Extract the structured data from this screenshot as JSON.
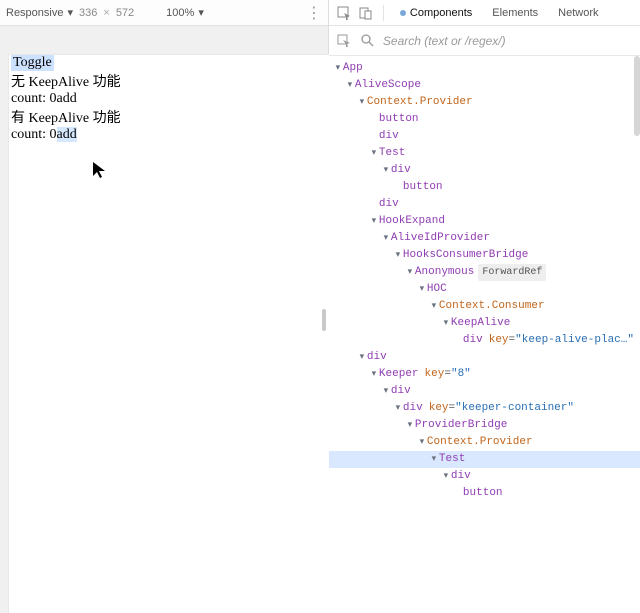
{
  "toolbar": {
    "device": "Responsive",
    "width": "336",
    "x": "×",
    "height": "572",
    "zoom": "100%",
    "kebab": "⋮"
  },
  "preview": {
    "toggle": "Toggle",
    "line1": "无 KeepAlive 功能",
    "line2_prefix": "count: 0",
    "line2_add": "add",
    "line3": "有 KeepAlive 功能",
    "line4_prefix": "count: 0",
    "line4_add": "add"
  },
  "tabs": {
    "components": "Components",
    "elements": "Elements",
    "network": "Network"
  },
  "search": {
    "placeholder": "Search (text or /regex/)"
  },
  "tree": [
    {
      "d": 0,
      "c": true,
      "cls": "nm",
      "t": "App"
    },
    {
      "d": 1,
      "c": true,
      "cls": "nm",
      "t": "AliveScope"
    },
    {
      "d": 2,
      "c": true,
      "cls": "nm-orange",
      "t": "Context.Provider"
    },
    {
      "d": 3,
      "c": false,
      "cls": "nm",
      "t": "button"
    },
    {
      "d": 3,
      "c": false,
      "cls": "nm",
      "t": "div"
    },
    {
      "d": 3,
      "c": true,
      "cls": "nm",
      "t": "Test"
    },
    {
      "d": 4,
      "c": true,
      "cls": "nm",
      "t": "div"
    },
    {
      "d": 5,
      "c": false,
      "cls": "nm",
      "t": "button"
    },
    {
      "d": 3,
      "c": false,
      "cls": "nm",
      "t": "div"
    },
    {
      "d": 3,
      "c": true,
      "cls": "nm",
      "t": "HookExpand"
    },
    {
      "d": 4,
      "c": true,
      "cls": "nm",
      "t": "AliveIdProvider"
    },
    {
      "d": 5,
      "c": true,
      "cls": "nm",
      "t": "HooksConsumerBridge"
    },
    {
      "d": 6,
      "c": true,
      "cls": "nm",
      "t": "Anonymous",
      "badge": "ForwardRef"
    },
    {
      "d": 7,
      "c": true,
      "cls": "nm",
      "t": "HOC"
    },
    {
      "d": 8,
      "c": true,
      "cls": "nm-orange",
      "t": "Context.Consumer"
    },
    {
      "d": 9,
      "c": true,
      "cls": "nm",
      "t": "KeepAlive"
    },
    {
      "d": 10,
      "c": false,
      "cls": "nm",
      "t": "div",
      "key": "keep-alive-plac…"
    },
    {
      "d": 2,
      "c": true,
      "cls": "nm",
      "t": "div"
    },
    {
      "d": 3,
      "c": true,
      "cls": "nm",
      "t": "Keeper",
      "key": "8"
    },
    {
      "d": 4,
      "c": true,
      "cls": "nm",
      "t": "div"
    },
    {
      "d": 5,
      "c": true,
      "cls": "nm",
      "t": "div",
      "key": "keeper-container"
    },
    {
      "d": 6,
      "c": true,
      "cls": "nm",
      "t": "ProviderBridge"
    },
    {
      "d": 7,
      "c": true,
      "cls": "nm-orange",
      "t": "Context.Provider"
    },
    {
      "d": 8,
      "c": true,
      "cls": "nm",
      "t": "Test",
      "selected": true
    },
    {
      "d": 9,
      "c": true,
      "cls": "nm",
      "t": "div"
    },
    {
      "d": 10,
      "c": false,
      "cls": "nm",
      "t": "button"
    }
  ],
  "kv_labels": {
    "key": "key"
  }
}
